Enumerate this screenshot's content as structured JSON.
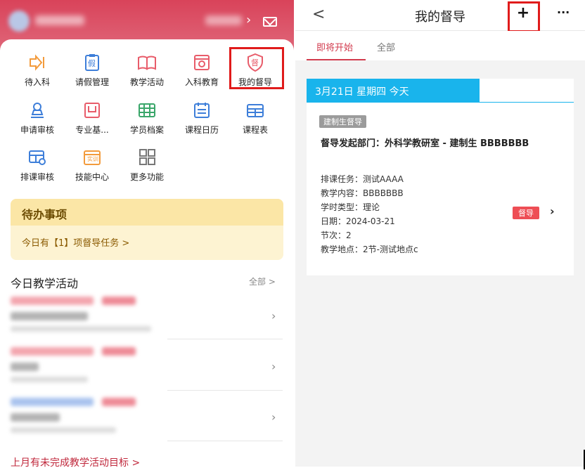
{
  "left": {
    "menu": [
      {
        "label": "待入科",
        "icon": "enter-dept-icon",
        "color": "#f39b3c"
      },
      {
        "label": "请假管理",
        "icon": "leave-icon",
        "color": "#3d7ed9"
      },
      {
        "label": "教学活动",
        "icon": "book-icon",
        "color": "#e85c6a"
      },
      {
        "label": "入科教育",
        "icon": "education-icon",
        "color": "#e85c6a"
      },
      {
        "label": "我的督导",
        "icon": "supervision-shield-icon",
        "color": "#e85c6a"
      },
      {
        "label": "申请审核",
        "icon": "stamp-icon",
        "color": "#3d7ed9"
      },
      {
        "label": "专业基...",
        "icon": "base-icon",
        "color": "#e85c6a"
      },
      {
        "label": "学员档案",
        "icon": "archive-icon",
        "color": "#3aa66a"
      },
      {
        "label": "课程日历",
        "icon": "calendar-icon",
        "color": "#3d7ed9"
      },
      {
        "label": "课程表",
        "icon": "schedule-icon",
        "color": "#3d7ed9"
      },
      {
        "label": "排课审核",
        "icon": "schedule-review-icon",
        "color": "#3d7ed9"
      },
      {
        "label": "技能中心",
        "icon": "skill-icon",
        "color": "#f39b3c"
      },
      {
        "label": "更多功能",
        "icon": "more-grid-icon",
        "color": "#777777"
      }
    ],
    "skill_badge": "实训",
    "leave_badge": "假",
    "supervise_badge": "督",
    "todo": {
      "title": "待办事项",
      "text": "今日有【1】项督导任务 >"
    },
    "today": {
      "title": "今日教学活动",
      "all_label": "全部 >"
    },
    "footer": "上月有未完成教学活动目标 >"
  },
  "right": {
    "back": "<",
    "title": "我的督导",
    "plus": "+",
    "more": "···",
    "tabs": [
      {
        "label": "即将开始"
      },
      {
        "label": "全部"
      }
    ],
    "date_header": "3月21日 星期四 今天",
    "card": {
      "type_badge": "建制生督导",
      "title": "督导发起部门：外科学教研室 - 建制生 BBBBBBB",
      "details": [
        "排课任务：测试AAAA",
        "教学内容：BBBBBBB",
        "学时类型：理论",
        "日期：2024-03-21",
        "节次：2",
        "教学地点：2节-测试地点c"
      ],
      "status_badge": "督导"
    }
  },
  "colors": {
    "brand_red": "#d9435a",
    "highlight": "#e01b1b",
    "date_blue": "#19b4ec"
  }
}
